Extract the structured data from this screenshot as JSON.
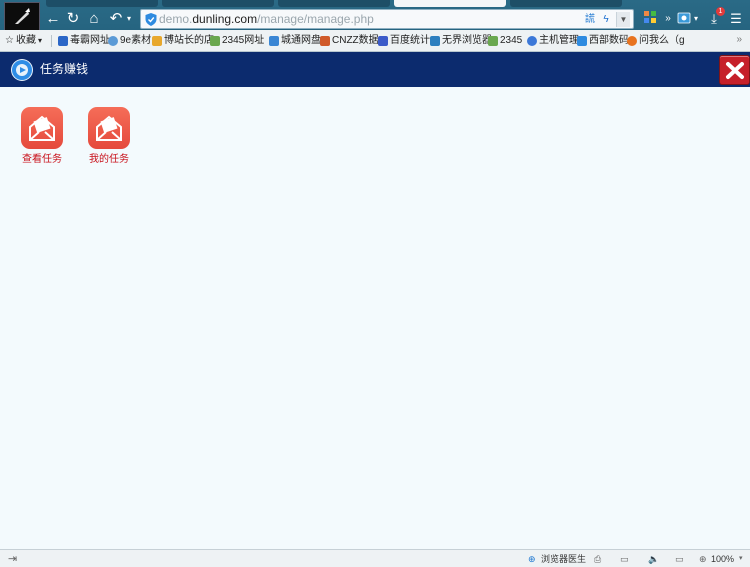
{
  "browser": {
    "url_host": "demo.",
    "url_domain": "dunling.com",
    "url_path": "/manage/manage.php",
    "nav_back": "←",
    "nav_reload": "↻",
    "nav_home": "⌂",
    "nav_undo": "↶",
    "security_icon": "shield-icon",
    "zoom_level": "100%"
  },
  "bookmarks": {
    "favorites_label": "收藏",
    "items": [
      "毒霸网址",
      "9e素材",
      "博站长的店",
      "2345网址",
      "城通网盘",
      "CNZZ数据",
      "百度统计",
      "无界浏览器",
      "2345",
      "主机管理",
      "西部数码",
      "问我么（g"
    ]
  },
  "app_header": {
    "title": "任务赚钱",
    "accent_color": "#0c2b6e",
    "close_color": "#c6202a"
  },
  "tiles": [
    {
      "label": "查看任务",
      "icon": "envelope-icon"
    },
    {
      "label": "我的任务",
      "icon": "envelope-icon"
    }
  ],
  "status_bar": {
    "doctor_label": "浏览器医生",
    "zoom": "100%"
  }
}
